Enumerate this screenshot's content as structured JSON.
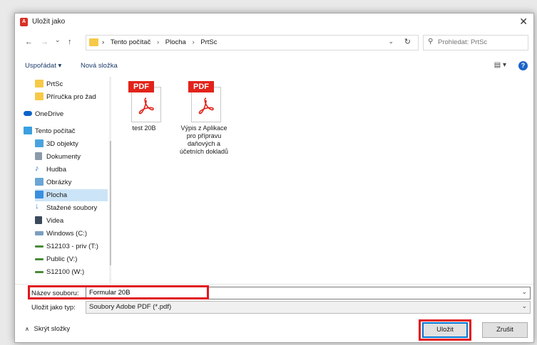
{
  "window": {
    "title": "Uložit jako",
    "close_glyph": "✕"
  },
  "nav_buttons": {
    "back": "←",
    "forward": "→",
    "recent": "⌄",
    "up": "↑"
  },
  "address": {
    "crumbs": [
      "Tento počítač",
      "Plocha",
      "PrtSc"
    ],
    "separator": "›",
    "dropdown_glyph": "⌄",
    "refresh_glyph": "↻"
  },
  "search": {
    "placeholder": "Prohledat: PrtSc",
    "icon": "search-icon"
  },
  "toolbar": {
    "organize": "Uspořádat ▾",
    "new_folder": "Nová složka",
    "view_glyph": "▤ ▾",
    "help": "?"
  },
  "sidebar": {
    "items": [
      {
        "label": "PrtSc",
        "icon": "folder-icon",
        "color": "#f7c948"
      },
      {
        "label": "Příručka pro žad",
        "icon": "folder-icon",
        "color": "#f7c948"
      },
      {
        "label": "OneDrive",
        "icon": "cloud-icon",
        "color": "#0a64c8"
      },
      {
        "label": "Tento počítač",
        "icon": "computer-icon",
        "color": "#3aa0e0"
      },
      {
        "label": "3D objekty",
        "icon": "cube-icon",
        "color": "#4aa3df"
      },
      {
        "label": "Dokumenty",
        "icon": "document-icon",
        "color": "#8a9aa8"
      },
      {
        "label": "Hudba",
        "icon": "music-icon",
        "color": "#2b6cc4"
      },
      {
        "label": "Obrázky",
        "icon": "pictures-icon",
        "color": "#6ba6d6"
      },
      {
        "label": "Plocha",
        "icon": "desktop-icon",
        "color": "#3a8ee0",
        "selected": true
      },
      {
        "label": "Stažené soubory",
        "icon": "download-icon",
        "color": "#2f7fd6"
      },
      {
        "label": "Videa",
        "icon": "video-icon",
        "color": "#3b4a5a"
      },
      {
        "label": "Windows (C:)",
        "icon": "drive-icon",
        "color": "#7aa0c0"
      },
      {
        "label": "S12103 - priv (T:)",
        "icon": "network-drive-icon",
        "color": "#4a8a3a"
      },
      {
        "label": "Public (V:)",
        "icon": "network-drive-icon",
        "color": "#4a8a3a"
      },
      {
        "label": "S12100 (W:)",
        "icon": "network-drive-icon",
        "color": "#4a8a3a"
      }
    ]
  },
  "files": [
    {
      "name": "test 20B",
      "type_badge": "PDF"
    },
    {
      "name": "Výpis z Aplikace pro přípravu daňových a účetních dokladů",
      "type_badge": "PDF"
    }
  ],
  "form": {
    "filename_label": "Název souboru:",
    "filename_value": "Formular 20B",
    "filetype_label": "Uložit jako typ:",
    "filetype_value": "Soubory Adobe PDF (*.pdf)"
  },
  "footer": {
    "hide_folders": "Skrýt složky",
    "save": "Uložit",
    "cancel": "Zrušit"
  },
  "colors": {
    "highlight_red": "#e2171e",
    "accent": "#0078d7",
    "pdf_red": "#e2231a"
  }
}
